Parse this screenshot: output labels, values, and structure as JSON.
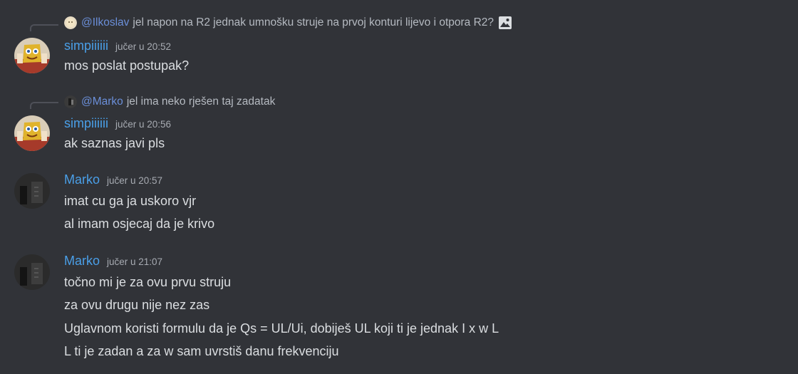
{
  "messages": [
    {
      "reply": {
        "mention": "@Ilkoslav",
        "text": "jel napon na R2 jednak umnošku struje na prvoj konturi lijevo i otpora R2?",
        "attachment_icon": "image-icon"
      },
      "author": "simpiiiiii",
      "time": "jučer u 20:52",
      "lines": [
        "mos poslat postupak?"
      ]
    },
    {
      "reply": {
        "mention": "@Marko",
        "text": "jel ima neko rješen taj zadatak"
      },
      "author": "simpiiiiii",
      "time": "jučer u 20:56",
      "lines": [
        "ak saznas javi pls"
      ]
    },
    {
      "author": "Marko",
      "time": "jučer u 20:57",
      "lines": [
        "imat cu ga ja uskoro vjr",
        "al imam osjecaj da je krivo"
      ]
    },
    {
      "author": "Marko",
      "time": "jučer u 21:07",
      "lines": [
        "točno mi je za ovu prvu struju",
        "za ovu drugu nije nez zas",
        "Uglavnom koristi formulu da je Qs = UL/Ui, dobiješ UL koji ti je jednak I x w L",
        "L ti je zadan a za w sam uvrstiš danu frekvenciju"
      ]
    }
  ],
  "colors": {
    "background": "#313338",
    "username": "#4a9fe8",
    "mention": "#6b8fd9",
    "text": "#dbdee1",
    "muted": "#a7abb2"
  }
}
